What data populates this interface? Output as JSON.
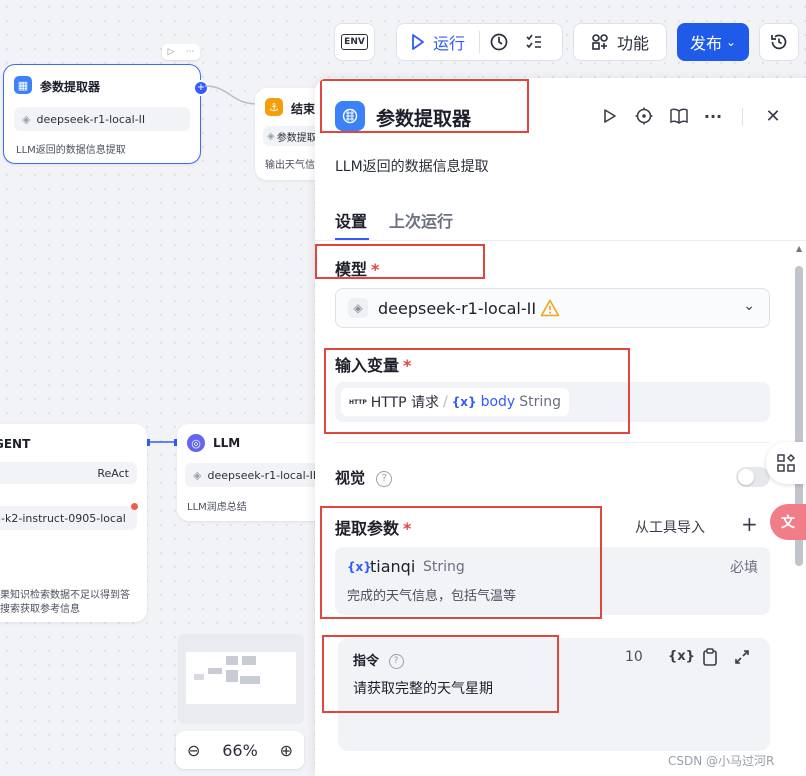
{
  "toolbar": {
    "env_label": "ENV",
    "run_label": "运行",
    "features_label": "功能",
    "publish_label": "发布"
  },
  "canvas": {
    "extractor_node": {
      "title": "参数提取器",
      "model": "deepseek-r1-local-II",
      "desc": "LLM返回的数据信息提取"
    },
    "end_node": {
      "title": "结束",
      "var_chip": "参数提取",
      "output": "输出天气信"
    },
    "agent_node": {
      "title": "GENT",
      "strategy": "ReAct",
      "model": "i-k2-instruct-0905-local",
      "desc_line1": "果知识检索数据不足以得到答",
      "desc_line2": "搜索获取参考信息"
    },
    "llm_node": {
      "title": "LLM",
      "model": "deepseek-r1-local-II",
      "desc": "LLM润虑总结"
    },
    "zoom": "66%",
    "watermark": "CSDN @小马过河R"
  },
  "panel": {
    "title": "参数提取器",
    "description": "LLM返回的数据信息提取",
    "tabs": [
      {
        "label": "设置",
        "active": true
      },
      {
        "label": "上次运行",
        "active": false
      }
    ],
    "model_section": {
      "label": "模型",
      "required_mark": "*",
      "model_name": "deepseek-r1-local-II"
    },
    "input_section": {
      "label": "输入变量",
      "required_mark": "*",
      "var_tag": "HTTP",
      "var_node": "HTTP 请求",
      "separator": "/",
      "var_symbol": "{x}",
      "var_name": "body",
      "var_type": "String"
    },
    "vision_section": {
      "label": "视觉",
      "help": "?"
    },
    "params_section": {
      "label": "提取参数",
      "required_mark": "*",
      "import_label": "从工具导入",
      "add_label": "+",
      "param": {
        "symbol": "{x}",
        "name": "tianqi",
        "type": "String",
        "required_badge": "必填",
        "description": "完成的天气信息，包括气温等"
      }
    },
    "instruction_section": {
      "label": "指令",
      "help": "?",
      "count": "10",
      "var_symbol": "{x}",
      "text": "请获取完整的天气星期"
    }
  },
  "colors": {
    "accent": "#2f5bff",
    "publish_bg": "#1f5ae8",
    "highlight_red": "#e0463e",
    "warning": "#f2a21b"
  }
}
